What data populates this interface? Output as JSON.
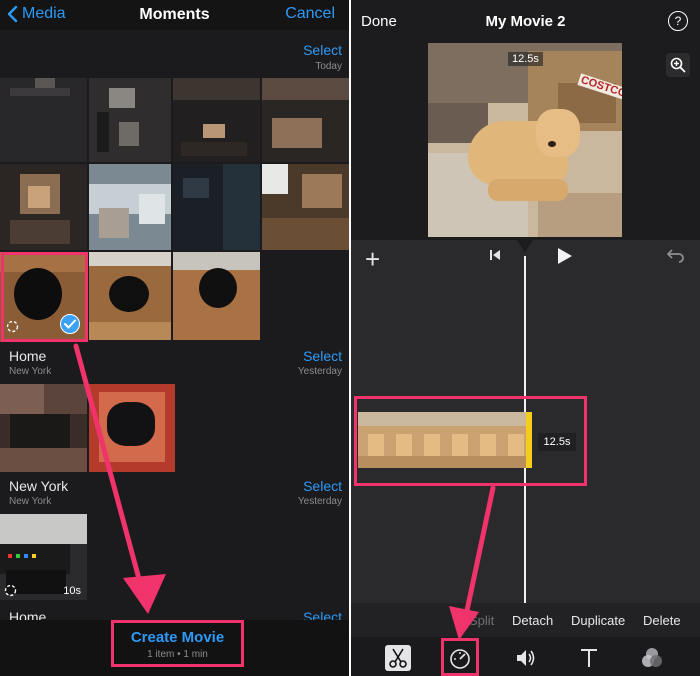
{
  "left": {
    "nav": {
      "back_label": "Media",
      "title": "Moments",
      "cancel_label": "Cancel"
    },
    "sections": [
      {
        "title": "",
        "location": "",
        "select_label": "Select",
        "date_label": "Today"
      },
      {
        "title": "Home",
        "location": "New York",
        "select_label": "Select",
        "date_label": "Yesterday"
      },
      {
        "title": "New York",
        "location": "New York",
        "select_label": "Select",
        "date_label": "Yesterday"
      },
      {
        "title": "Home",
        "location": "",
        "select_label": "Select",
        "date_label": ""
      }
    ],
    "video_duration": "10s",
    "create_movie": {
      "label": "Create Movie",
      "sublabel": "1 item • 1 min"
    },
    "colors": {
      "accent": "#2d9af7",
      "highlight": "#f0336b"
    }
  },
  "right": {
    "nav": {
      "done_label": "Done",
      "title": "My Movie 2",
      "help_label": "?"
    },
    "preview_duration": "12.5s",
    "preview_box_text": "COSTCO",
    "clip_duration": "12.5s",
    "actions": [
      "Split",
      "Detach",
      "Duplicate",
      "Delete"
    ],
    "tools": [
      "scissors-icon",
      "speedometer-icon",
      "volume-icon",
      "text-icon",
      "filters-icon"
    ],
    "colors": {
      "clip_handle": "#f5cc1c"
    }
  }
}
